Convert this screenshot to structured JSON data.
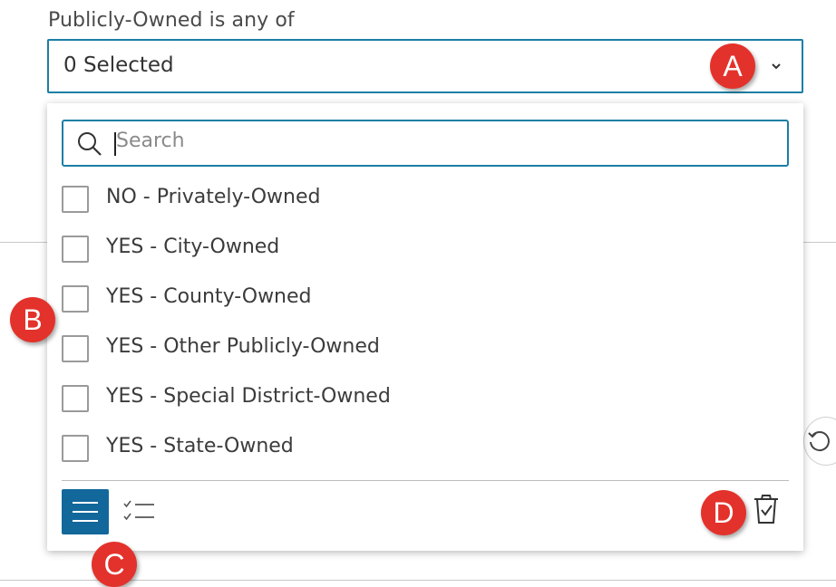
{
  "filter": {
    "label": "Publicly-Owned is any of",
    "selected_text": "0 Selected",
    "chevron_icon": "chevron-down-icon"
  },
  "search": {
    "placeholder": "Search",
    "value": "",
    "icon": "search-icon"
  },
  "options": [
    {
      "label": "NO - Privately-Owned",
      "checked": false
    },
    {
      "label": "YES - City-Owned",
      "checked": false
    },
    {
      "label": "YES - County-Owned",
      "checked": false
    },
    {
      "label": "YES - Other Publicly-Owned",
      "checked": false
    },
    {
      "label": "YES - Special District-Owned",
      "checked": false
    },
    {
      "label": "YES - State-Owned",
      "checked": false
    }
  ],
  "footer": {
    "list_view_icon": "list-icon",
    "list_view_active": true,
    "selected_view_icon": "checklist-icon",
    "clear_icon": "trash-check-icon"
  },
  "reset_icon": "reset-icon",
  "callouts": {
    "a": "A",
    "b": "B",
    "c": "C",
    "d": "D"
  },
  "colors": {
    "accent": "#1a7fa5",
    "active_button": "#12679b",
    "callout": "#e3322b"
  }
}
